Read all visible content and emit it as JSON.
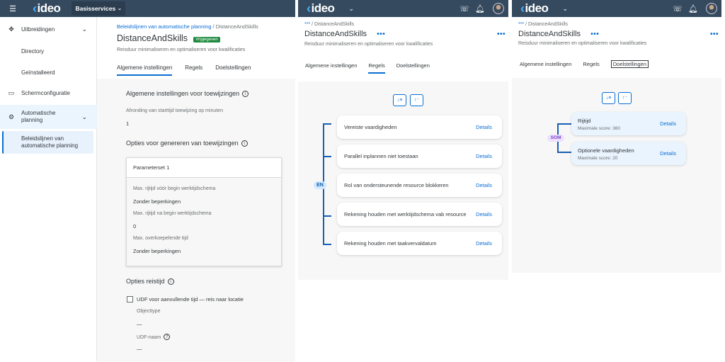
{
  "shell": {
    "brand": "ideo",
    "workspace": "Basisservices"
  },
  "panel1": {
    "sidebar": [
      {
        "label": "Uitbreidingen",
        "icon": "extensions-icon"
      },
      {
        "label": "Directory"
      },
      {
        "label": "Geïnstalleerd"
      },
      {
        "label": "Schermconfiguratie",
        "icon": "monitor-icon"
      },
      {
        "label_line1": "Automatische",
        "label_line2": "planning",
        "icon": "gear-icon"
      },
      {
        "label_line1": "Beleidslijnen van",
        "label_line2": "automatische planning"
      }
    ],
    "breadcrumb_link": "Beleidslijnen van automatische planning",
    "breadcrumb_sep": "/",
    "breadcrumb_current": "DistanceAndSkills",
    "title": "DistanceAndSkills",
    "status_badge": "Vrijgegeven",
    "subtitle": "Reisduur minimaliseren en optimaliseren voor kwalificaties",
    "tabs": [
      "Algemene instellingen",
      "Regels",
      "Doelstellingen"
    ],
    "section1_title": "Algemene instellingen voor toewijzingen",
    "rounding_label": "Afronding van starttijd toewijzing op minuten",
    "rounding_value": "1",
    "section2_title": "Opties voor genereren van toewijzingen",
    "paramset_title": "Parameterset 1",
    "params": [
      {
        "label": "Max. rijtijd vóór begin werktijdschema",
        "value": "Zonder beperkingen"
      },
      {
        "label": "Max. rijtijd na begin werktijdschema",
        "value": "0"
      },
      {
        "label": "Max. overkoepelende tijd",
        "value": "Zonder beperkingen"
      }
    ],
    "section3_title": "Opties reistijd",
    "udf_checkbox_label": "UDF voor aanvullende tijd — reis naar locatie",
    "object_type_label": "Objecttype",
    "object_type_value": "—",
    "udf_name_label": "UDF-naam",
    "udf_name_value": "—"
  },
  "panel2": {
    "breadcrumb_prefix": "***",
    "breadcrumb": "/ DistanceAndSkills",
    "title": "DistanceAndSkills",
    "subtitle": "Reisduur minimaliseren en optimaliseren voor kwalificaties",
    "tabs": [
      "Algemene instellingen",
      "Regels",
      "Doelstellingen"
    ],
    "operator": "EN",
    "details_label": "Details",
    "rules": [
      "Vereiste vaardigheden",
      "Parallel inplannen niet toestaan",
      "Rol van ondersteunende resource blokkeren",
      "Rekening houden met werktijdschema vab resource",
      "Rekening houden met taakvervaldatum"
    ]
  },
  "panel3": {
    "breadcrumb_prefix": "***",
    "breadcrumb": "/ DistanceAndSkills",
    "title": "DistanceAndSkills",
    "subtitle": "Reisduur minimaliseren en optimaliseren voor kwalificaties",
    "tabs": [
      "Algemene instellingen",
      "Regels",
      "Doelstellingen"
    ],
    "operator": "SOM",
    "details_label": "Details",
    "objectives": [
      {
        "name": "Rijtijd",
        "score": "Maximale score: 360"
      },
      {
        "name": "Optionele vaardigheden",
        "score": "Maximale score: 20"
      }
    ]
  }
}
